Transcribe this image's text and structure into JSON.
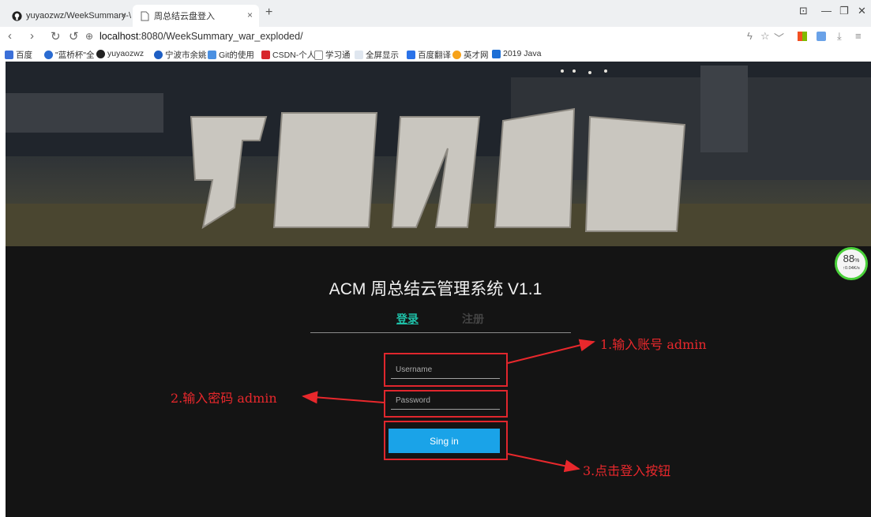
{
  "browser": {
    "tabs": [
      {
        "title": "yuyaozwz/WeekSummary-\\",
        "active": false
      },
      {
        "title": "周总结云盘登入",
        "active": true
      }
    ],
    "new_tab": "+",
    "url_host": "localhost",
    "url_rest": ":8080/WeekSummary_war_exploded/",
    "bookmarks": [
      "百度",
      "\"蓝桥杯\"全",
      "yuyaozwz",
      "宁波市余姚",
      "Git的使用",
      "CSDN-个人",
      "学习通",
      "全屏显示",
      "百度翻译",
      "英才网",
      "2019 Java"
    ]
  },
  "speed_widget": {
    "percent": "88",
    "unit": "%",
    "rate": "↑0.04K/s"
  },
  "page": {
    "title": "ACM 周总结云管理系统 V1.1",
    "tab_login": "登录",
    "tab_register": "注册",
    "username_placeholder": "Username",
    "password_placeholder": "Password",
    "signin_label": "Sing in"
  },
  "annotations": {
    "step1": "1.输入账号 admin",
    "step2": "2.输入密码 admin",
    "step3": "3.点击登入按钮"
  },
  "colors": {
    "accent": "#1fc0a8",
    "button": "#1aa3e8",
    "annotation": "#e8282c"
  }
}
